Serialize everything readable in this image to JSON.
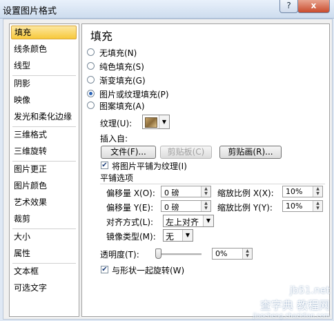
{
  "window": {
    "title": "设置图片格式",
    "help_label": "?",
    "close_label": "x"
  },
  "sidebar": {
    "items": [
      {
        "label": "填充"
      },
      {
        "label": "线条颜色"
      },
      {
        "label": "线型"
      },
      {
        "label": "阴影"
      },
      {
        "label": "映像"
      },
      {
        "label": "发光和柔化边缘"
      },
      {
        "label": "三维格式"
      },
      {
        "label": "三维旋转"
      },
      {
        "label": "图片更正"
      },
      {
        "label": "图片颜色"
      },
      {
        "label": "艺术效果"
      },
      {
        "label": "裁剪"
      },
      {
        "label": "大小"
      },
      {
        "label": "属性"
      },
      {
        "label": "文本框"
      },
      {
        "label": "可选文字"
      }
    ],
    "selected": "填充"
  },
  "panel": {
    "heading": "填充",
    "fill_options": [
      {
        "label": "无填充(N)",
        "selected": false
      },
      {
        "label": "纯色填充(S)",
        "selected": false
      },
      {
        "label": "渐变填充(G)",
        "selected": false
      },
      {
        "label": "图片或纹理填充(P)",
        "selected": true
      },
      {
        "label": "图案填充(A)",
        "selected": false
      }
    ],
    "texture_label": "纹理(U):",
    "insert_from_label": "插入自:",
    "file_button": "文件(F)...",
    "clipboard_button": "剪贴板(C)",
    "clipart_button": "剪贴画(R)...",
    "tile_checkbox": {
      "label": "将图片平铺为纹理(I)",
      "checked": true
    },
    "tiling_options_label": "平铺选项",
    "offset_x": {
      "label": "偏移量 X(O):",
      "value": "0 磅"
    },
    "offset_y": {
      "label": "偏移量 Y(E):",
      "value": "0 磅"
    },
    "scale_x": {
      "label": "缩放比例 X(X):",
      "value": "10%"
    },
    "scale_y": {
      "label": "缩放比例 Y(Y):",
      "value": "10%"
    },
    "alignment": {
      "label": "对齐方式(L):",
      "value": "左上对齐"
    },
    "mirror_type": {
      "label": "镜像类型(M):",
      "value": "无"
    },
    "transparency": {
      "label": "透明度(T):",
      "value": "0%",
      "level": 0
    },
    "rotate_checkbox": {
      "label": "与形状一起旋转(W)",
      "checked": true
    }
  },
  "watermark": {
    "line1": "jb51.net",
    "line2": "查字典 教程网",
    "line3": "jiaocheng.chazidian.com"
  }
}
